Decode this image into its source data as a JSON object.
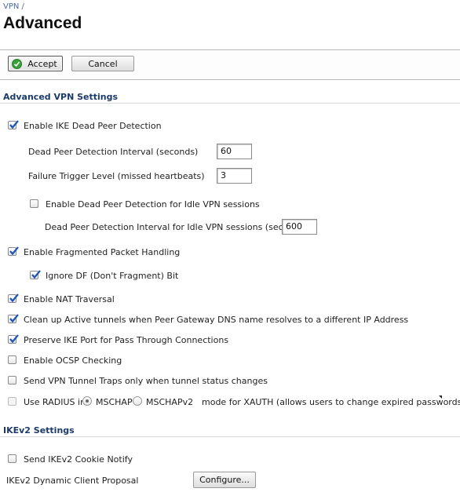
{
  "breadcrumb": "VPN /",
  "title": "Advanced",
  "toolbar": {
    "accept_label": "Accept",
    "cancel_label": "Cancel"
  },
  "advanced_vpn": {
    "section_title": "Advanced VPN Settings",
    "enable_ike_dpd": {
      "label": "Enable IKE Dead Peer Detection",
      "checked": true
    },
    "dpd_interval": {
      "label": "Dead Peer Detection Interval (seconds)",
      "value": "60"
    },
    "failure_trigger": {
      "label": "Failure Trigger Level (missed heartbeats)",
      "value": "3"
    },
    "enable_idle_dpd": {
      "label": "Enable Dead Peer Detection for Idle VPN sessions",
      "checked": false
    },
    "idle_dpd_interval": {
      "label": "Dead Peer Detection Interval for Idle VPN sessions (seconds)",
      "value": "600"
    },
    "fragmented": {
      "label": "Enable Fragmented Packet Handling",
      "checked": true
    },
    "ignore_df": {
      "label": "Ignore DF (Don't Fragment) Bit",
      "checked": true
    },
    "nat_traversal": {
      "label": "Enable NAT Traversal",
      "checked": true
    },
    "cleanup_tunnels": {
      "label": "Clean up Active tunnels when Peer Gateway DNS name resolves to a different IP Address",
      "checked": true
    },
    "preserve_ike_port": {
      "label": "Preserve IKE Port for Pass Through Connections",
      "checked": true
    },
    "ocsp": {
      "label": "Enable OCSP Checking",
      "checked": false
    },
    "tunnel_traps": {
      "label": "Send VPN Tunnel Traps only when tunnel status changes",
      "checked": false
    },
    "radius": {
      "label_prefix": "Use RADIUS in",
      "option1": "MSCHAP",
      "option2": "MSCHAPv2",
      "label_suffix": "mode for XAUTH (allows users to change expired passwords)",
      "selected": "MSCHAP",
      "checked": false
    }
  },
  "ikev2": {
    "section_title": "IKEv2 Settings",
    "cookie_notify": {
      "label": "Send IKEv2 Cookie Notify",
      "checked": false
    },
    "dynamic_client_proposal": {
      "label": "IKEv2 Dynamic Client Proposal",
      "button_label": "Configure..."
    }
  },
  "colors": {
    "section_title": "#1c3a6a",
    "breadcrumb": "#4a6aa0",
    "accept_icon": "#3aa13a"
  }
}
